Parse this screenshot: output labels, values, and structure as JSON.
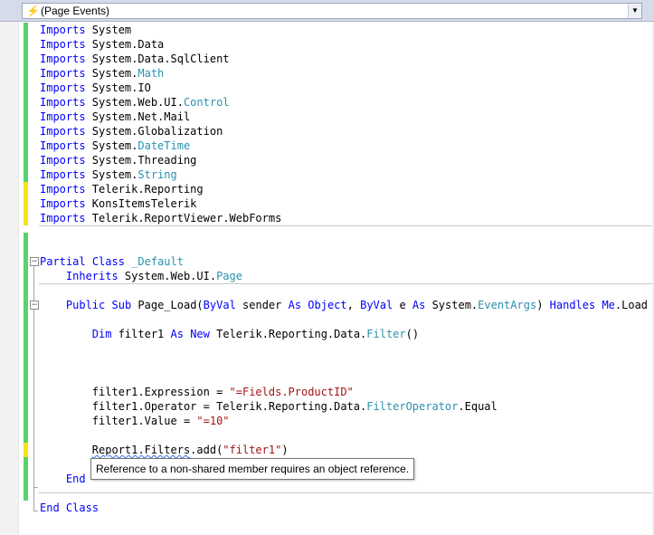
{
  "member_dropdown": {
    "label": "(Page Events)"
  },
  "code_lines": [
    [
      {
        "t": "Imports",
        "c": "kw"
      },
      {
        "t": " System"
      }
    ],
    [
      {
        "t": "Imports",
        "c": "kw"
      },
      {
        "t": " System.Data"
      }
    ],
    [
      {
        "t": "Imports",
        "c": "kw"
      },
      {
        "t": " System.Data.SqlClient"
      }
    ],
    [
      {
        "t": "Imports",
        "c": "kw"
      },
      {
        "t": " System."
      },
      {
        "t": "Math",
        "c": "ty"
      }
    ],
    [
      {
        "t": "Imports",
        "c": "kw"
      },
      {
        "t": " System.IO"
      }
    ],
    [
      {
        "t": "Imports",
        "c": "kw"
      },
      {
        "t": " System.Web.UI."
      },
      {
        "t": "Control",
        "c": "ty"
      }
    ],
    [
      {
        "t": "Imports",
        "c": "kw"
      },
      {
        "t": " System.Net.Mail"
      }
    ],
    [
      {
        "t": "Imports",
        "c": "kw"
      },
      {
        "t": " System.Globalization"
      }
    ],
    [
      {
        "t": "Imports",
        "c": "kw"
      },
      {
        "t": " System."
      },
      {
        "t": "DateTime",
        "c": "ty"
      }
    ],
    [
      {
        "t": "Imports",
        "c": "kw"
      },
      {
        "t": " System.Threading"
      }
    ],
    [
      {
        "t": "Imports",
        "c": "kw"
      },
      {
        "t": " System."
      },
      {
        "t": "String",
        "c": "ty"
      }
    ],
    [
      {
        "t": "Imports",
        "c": "kw"
      },
      {
        "t": " Telerik.Reporting"
      }
    ],
    [
      {
        "t": "Imports",
        "c": "kw"
      },
      {
        "t": " KonsItemsTelerik"
      }
    ],
    [
      {
        "t": "Imports",
        "c": "kw"
      },
      {
        "t": " Telerik.ReportViewer.WebForms"
      }
    ],
    [],
    [],
    [
      {
        "t": "Partial",
        "c": "kw"
      },
      {
        "t": " "
      },
      {
        "t": "Class",
        "c": "kw"
      },
      {
        "t": " "
      },
      {
        "t": "_Default",
        "c": "ty"
      }
    ],
    [
      {
        "t": "    "
      },
      {
        "t": "Inherits",
        "c": "kw"
      },
      {
        "t": " System.Web.UI."
      },
      {
        "t": "Page",
        "c": "ty"
      }
    ],
    [],
    [
      {
        "t": "    "
      },
      {
        "t": "Public",
        "c": "kw"
      },
      {
        "t": " "
      },
      {
        "t": "Sub",
        "c": "kw"
      },
      {
        "t": " Page_Load("
      },
      {
        "t": "ByVal",
        "c": "kw"
      },
      {
        "t": " sender "
      },
      {
        "t": "As",
        "c": "kw"
      },
      {
        "t": " "
      },
      {
        "t": "Object",
        "c": "kw"
      },
      {
        "t": ", "
      },
      {
        "t": "ByVal",
        "c": "kw"
      },
      {
        "t": " e "
      },
      {
        "t": "As",
        "c": "kw"
      },
      {
        "t": " System."
      },
      {
        "t": "EventArgs",
        "c": "ty"
      },
      {
        "t": ") "
      },
      {
        "t": "Handles",
        "c": "kw"
      },
      {
        "t": " "
      },
      {
        "t": "Me",
        "c": "kw"
      },
      {
        "t": ".Load"
      }
    ],
    [],
    [
      {
        "t": "        "
      },
      {
        "t": "Dim",
        "c": "kw"
      },
      {
        "t": " filter1 "
      },
      {
        "t": "As",
        "c": "kw"
      },
      {
        "t": " "
      },
      {
        "t": "New",
        "c": "kw"
      },
      {
        "t": " Telerik.Reporting.Data."
      },
      {
        "t": "Filter",
        "c": "ty"
      },
      {
        "t": "()"
      }
    ],
    [],
    [],
    [],
    [
      {
        "t": "        filter1.Expression = "
      },
      {
        "t": "\"=Fields.ProductID\"",
        "c": "str"
      }
    ],
    [
      {
        "t": "        filter1.Operator = Telerik.Reporting.Data."
      },
      {
        "t": "FilterOperator",
        "c": "ty"
      },
      {
        "t": ".Equal"
      }
    ],
    [
      {
        "t": "        filter1.Value = "
      },
      {
        "t": "\"=10\"",
        "c": "str"
      }
    ],
    [],
    [
      {
        "t": "        "
      },
      {
        "t": "Report1.Filters",
        "c": "squiggle"
      },
      {
        "t": ".add("
      },
      {
        "t": "\"filter1\"",
        "c": "str"
      },
      {
        "t": ")"
      }
    ],
    [],
    [
      {
        "t": "    "
      },
      {
        "t": "End",
        "c": "kw"
      }
    ],
    [],
    [
      {
        "t": "End",
        "c": "kw"
      },
      {
        "t": " "
      },
      {
        "t": "Class",
        "c": "kw"
      }
    ]
  ],
  "tooltip": {
    "text": "Reference to a non-shared member requires an object reference."
  },
  "colors": {
    "keyword": "#0000ff",
    "type": "#2b91af",
    "string": "#a31515",
    "change_saved": "#57d36a",
    "change_unsaved": "#f6e21b"
  }
}
